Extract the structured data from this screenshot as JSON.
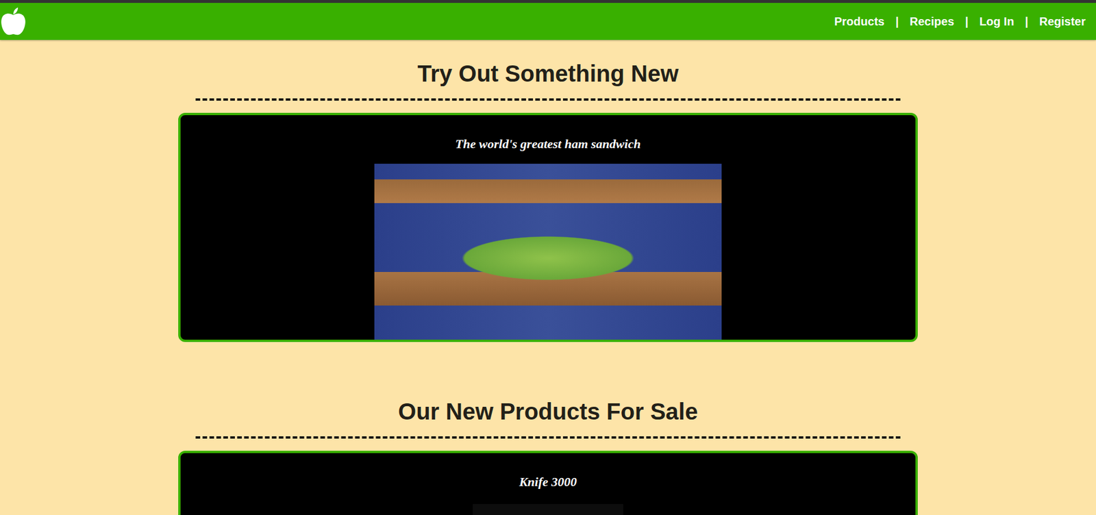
{
  "nav": {
    "links": [
      {
        "label": "Products"
      },
      {
        "label": "Recipes"
      },
      {
        "label": "Log In"
      },
      {
        "label": "Register"
      }
    ],
    "separator": "|"
  },
  "sections": [
    {
      "heading": "Try Out Something New",
      "card": {
        "title": "The world's greatest ham sandwich",
        "kind": "photo"
      }
    },
    {
      "heading": "Our New Products For Sale",
      "card": {
        "title": "Knife 3000",
        "kind": "product"
      }
    }
  ]
}
